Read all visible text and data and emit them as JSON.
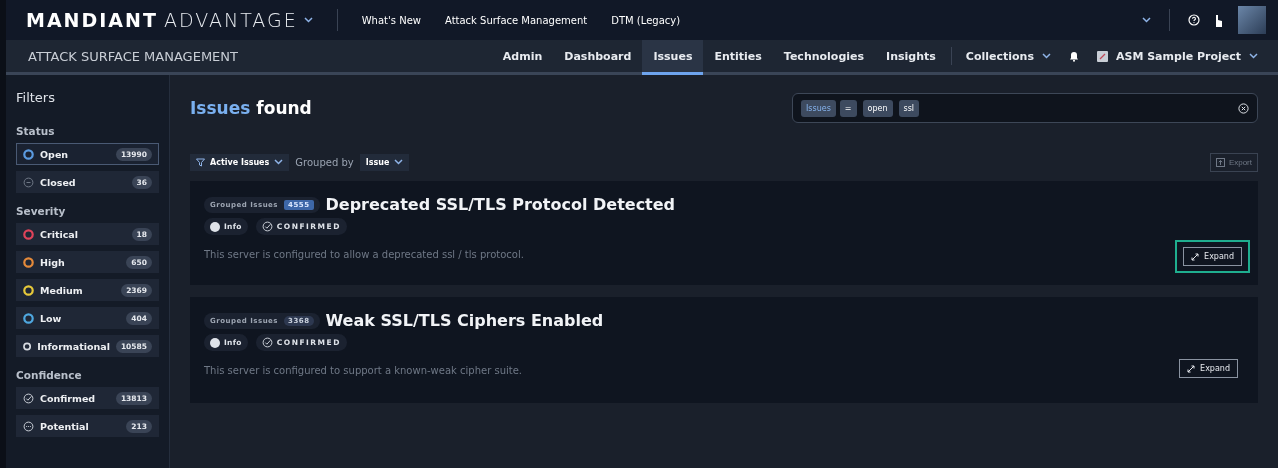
{
  "top_bar": {
    "brand_bold": "MANDIANT",
    "brand_light": "ADVANTAGE",
    "links": [
      "What's New",
      "Attack Surface Management",
      "DTM (Legacy)"
    ]
  },
  "app_bar": {
    "title": "ATTACK SURFACE MANAGEMENT",
    "tabs": [
      {
        "label": "Admin",
        "selected": false
      },
      {
        "label": "Dashboard",
        "selected": false
      },
      {
        "label": "Issues",
        "selected": true
      },
      {
        "label": "Entities",
        "selected": false
      },
      {
        "label": "Technologies",
        "selected": false
      },
      {
        "label": "Insights",
        "selected": false
      }
    ],
    "collections": "Collections",
    "project": "ASM Sample Project"
  },
  "filters": {
    "title": "Filters",
    "sections": [
      {
        "title": "Status",
        "items": [
          {
            "label": "Open",
            "count": "13990",
            "kind": "circle",
            "color": "#5b9be0",
            "selected": true
          },
          {
            "label": "Closed",
            "count": "36",
            "kind": "minus",
            "selected": false
          }
        ]
      },
      {
        "title": "Severity",
        "items": [
          {
            "label": "Critical",
            "count": "18",
            "kind": "circle",
            "color": "#e0435a",
            "selected": false
          },
          {
            "label": "High",
            "count": "650",
            "kind": "circle",
            "color": "#e58a3a",
            "selected": false
          },
          {
            "label": "Medium",
            "count": "2369",
            "kind": "circle",
            "color": "#e6c93a",
            "selected": false
          },
          {
            "label": "Low",
            "count": "404",
            "kind": "circle",
            "color": "#4fa8e0",
            "selected": false
          },
          {
            "label": "Informational",
            "count": "10585",
            "kind": "circle",
            "color": "#d8dce2",
            "selected": false
          }
        ]
      },
      {
        "title": "Confidence",
        "items": [
          {
            "label": "Confirmed",
            "count": "13813",
            "kind": "check",
            "selected": false
          },
          {
            "label": "Potential",
            "count": "213",
            "kind": "dots",
            "selected": false
          }
        ]
      }
    ]
  },
  "heading": {
    "accent": "Issues",
    "rest": "found"
  },
  "search": {
    "tokens": [
      {
        "text": "Issues",
        "kind": "field"
      },
      {
        "text": "=",
        "kind": "operator"
      },
      {
        "text": "open",
        "kind": "value"
      },
      {
        "text": "ssl",
        "kind": "value"
      }
    ]
  },
  "toolbar": {
    "view": "Active Issues",
    "grouped_label": "Grouped by",
    "grouped_value": "Issue",
    "export": "Export"
  },
  "issues": [
    {
      "group_label": "Grouped Issues",
      "count": "4555",
      "count_selected": true,
      "title": "Deprecated SSL/TLS Protocol Detected",
      "severity": "Info",
      "confidence": "CONFIRMED",
      "description": "This server is configured to allow a deprecated ssl / tls protocol.",
      "expand": "Expand",
      "highlighted": true
    },
    {
      "group_label": "Grouped Issues",
      "count": "3368",
      "count_selected": false,
      "title": "Weak SSL/TLS Ciphers Enabled",
      "severity": "Info",
      "confidence": "CONFIRMED",
      "description": "This server is configured to support a known-weak cipher suite.",
      "expand": "Expand",
      "highlighted": false
    }
  ]
}
